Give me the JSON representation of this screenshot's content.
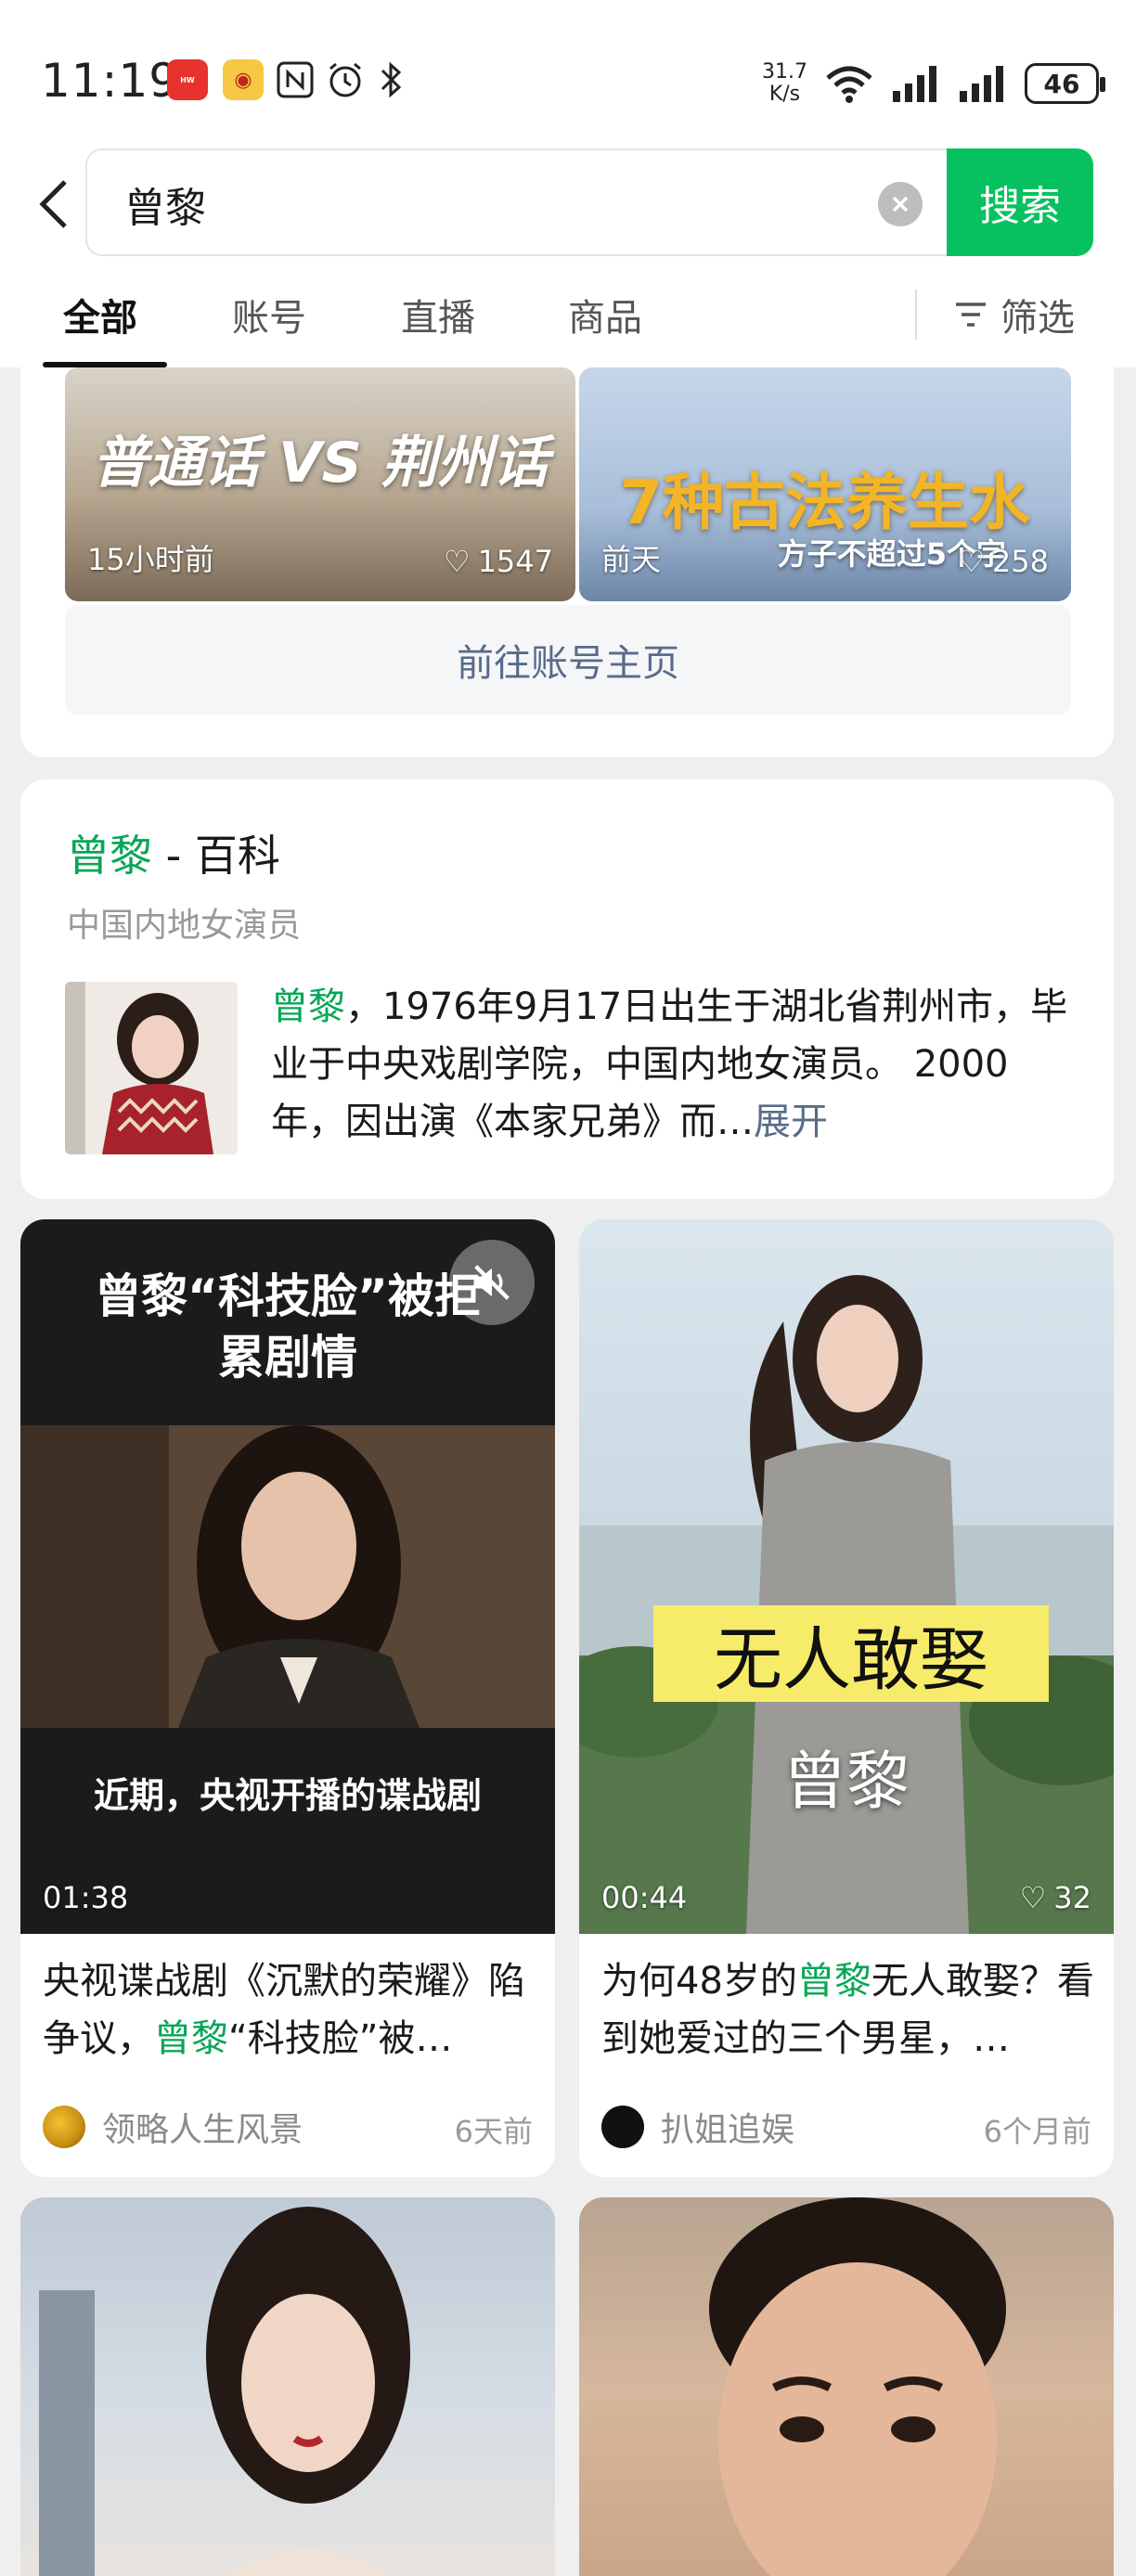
{
  "status": {
    "time": "11:19",
    "net_speed_value": "31.7",
    "net_speed_unit": "K/s",
    "battery": "46"
  },
  "search": {
    "query": "曾黎",
    "button": "搜索"
  },
  "tabs": [
    "全部",
    "账号",
    "直播",
    "商品"
  ],
  "filter": "筛选",
  "account_videos": [
    {
      "title": "普通话 VS 荆州话",
      "time": "15小时前",
      "likes": "1547"
    },
    {
      "title": "7种古法养生水",
      "subtitle": "方子不超过5个字",
      "time": "前天",
      "likes": "258"
    }
  ],
  "goto_account": "前往账号主页",
  "baike": {
    "name": "曾黎",
    "suffix": " - 百科",
    "subtitle": "中国内地女演员",
    "text": "，1976年9月17日出生于湖北省荆州市，毕业于中央戏剧学院，中国内地女演员。 2000年，因出演《本家兄弟》而…",
    "expand": "展开"
  },
  "videos": [
    {
      "cover_title_line1": "曾黎“科技脸”被拒",
      "cover_title_line2": "累剧情",
      "cover_caption": "近期，央视开播的谍战剧",
      "duration": "01:38",
      "title_before": "央视谍战剧《沉默的荣耀》陷争议，",
      "title_highlight": "曾黎",
      "title_after": "“科技脸”被…",
      "author": "领略人生风景",
      "time": "6天前"
    },
    {
      "cover_banner": "无人敢娶",
      "cover_name": "曾黎",
      "duration": "00:44",
      "likes": "32",
      "title_before": "为何48岁的",
      "title_highlight": "曾黎",
      "title_after": "无人敢娶？看到她爱过的三个男星，…",
      "author": "扒姐追娱",
      "time": "6个月前"
    }
  ],
  "colors": {
    "accent": "#07c160",
    "highlight": "#07a657",
    "link": "#586b8a"
  }
}
